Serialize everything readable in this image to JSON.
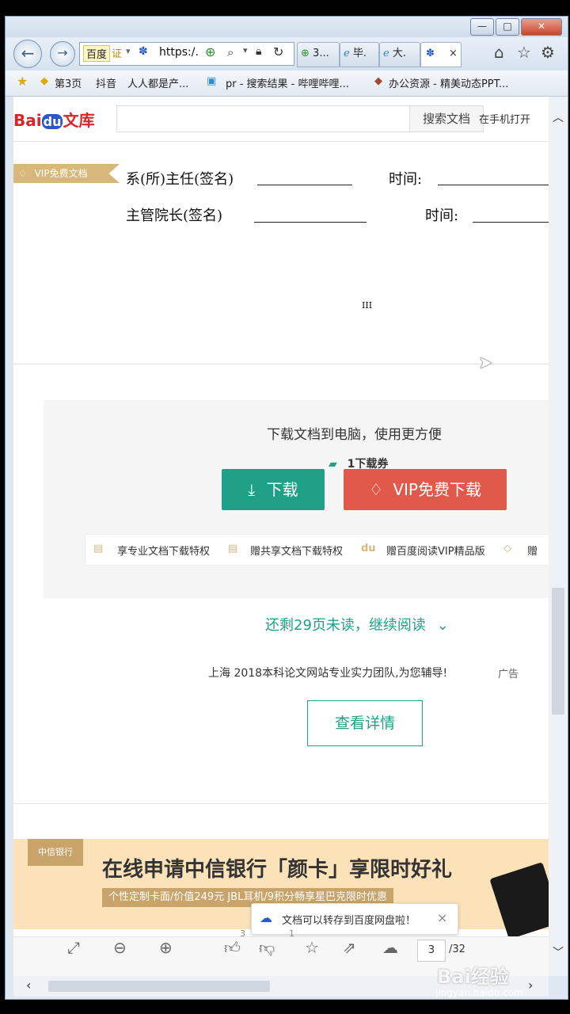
{
  "browser": {
    "address_prefix": "百度",
    "cert": "证",
    "address_text": "https:/.",
    "tabs": [
      "3...",
      "毕.",
      "大.",
      ""
    ],
    "tab_close": "×",
    "favorites": [
      "第3页",
      "抖音",
      "人人都是产...",
      "pr - 搜索结果 - 哔哩哔哩...",
      "办公资源 - 精美动态PPT..."
    ]
  },
  "header": {
    "logo_bai": "Bai",
    "logo_du": "du",
    "logo_wenku": "文库",
    "search_button": "搜索文档",
    "mobile_open": "在手机打开"
  },
  "document": {
    "vip_badge": "VIP免费文档",
    "line1_label": "系(所)主任(签名)",
    "line1_time": "时间:",
    "line2_label": "主管院长(签名)",
    "line2_time": "时间:",
    "page_roman": "III"
  },
  "download": {
    "tagline": "下载文档到电脑，使用更方便",
    "voucher": "1下载券",
    "download_button": "下载",
    "vip_button": "VIP免费下载",
    "privileges": [
      "享专业文档下载特权",
      "赠共享文档下载特权",
      "赠百度阅读VIP精品版",
      "赠"
    ]
  },
  "continue_reading": "还剩29页未读，继续阅读",
  "ad": {
    "text": "上海 2018本科论文网站专业实力团队,为您辅导!",
    "ad_label": "广告",
    "details_button": "查看详情"
  },
  "banner": {
    "bank_name": "中信银行",
    "headline": "在线申请中信银行「颜卡」享限时好礼",
    "subline": "个性定制卡面/价值249元 JBL耳机/9积分畅享星巴克限时优惠"
  },
  "toast": {
    "text": "文档可以转存到百度网盘啦！",
    "close": "×"
  },
  "toolbar": {
    "like_count": "3",
    "dislike_count": "1",
    "page_current": "3",
    "page_total": "/32"
  },
  "watermark": {
    "logo": "Bai经验",
    "url": "jingyan.baidu.com"
  },
  "colors": {
    "green": "#1fa087",
    "red": "#e0594b",
    "vip_gold": "#d8b77a",
    "banner_bg": "#fbe2b8"
  }
}
